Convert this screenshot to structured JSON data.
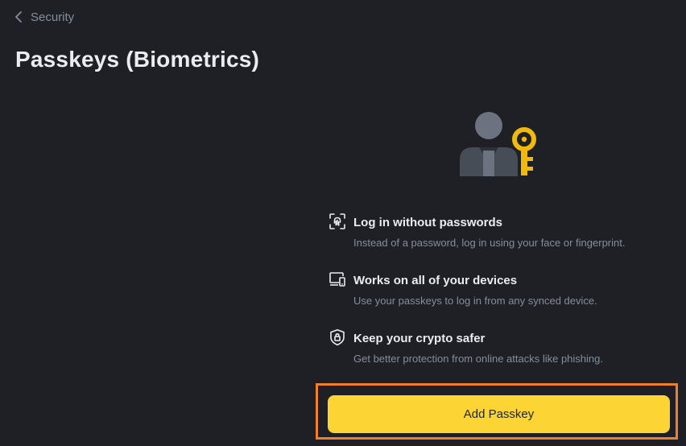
{
  "header": {
    "back_label": "Security",
    "title": "Passkeys (Biometrics)"
  },
  "hero": {
    "icon": "user-key-icon",
    "accent_color": "#F0B90B"
  },
  "features": [
    {
      "icon": "fingerprint-scan-icon",
      "title": "Log in without passwords",
      "description": "Instead of a password, log in using your face or fingerprint."
    },
    {
      "icon": "devices-icon",
      "title": "Works on all of your devices",
      "description": "Use your passkeys to log in from any synced device."
    },
    {
      "icon": "shield-lock-icon",
      "title": "Keep your crypto safer",
      "description": "Get better protection from online attacks like phishing."
    }
  ],
  "cta": {
    "label": "Add Passkey",
    "color": "#FCD535",
    "highlight_color": "#F0802E"
  }
}
